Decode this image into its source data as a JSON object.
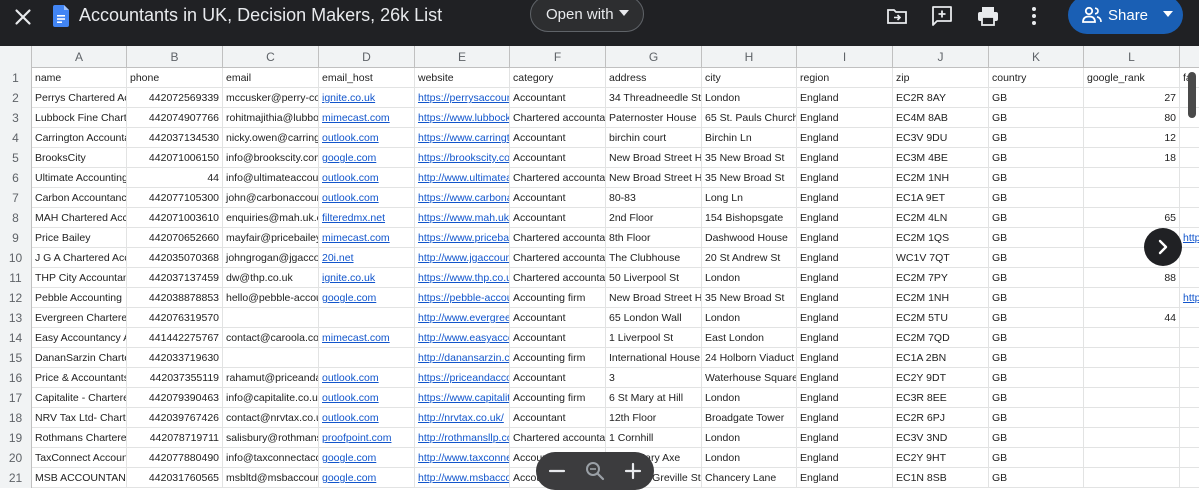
{
  "app": {
    "title": "Accountants in UK, Decision Makers, 26k List",
    "open_with_label": "Open with",
    "share_label": "Share"
  },
  "icons": {
    "close": "close-icon",
    "doc": "google-sheets-doc-icon",
    "move_to_folder": "move-to-folder-icon",
    "add_comment": "add-comment-icon",
    "print": "print-icon",
    "more": "more-vert-icon",
    "share_people": "people-icon",
    "next": "chevron-right-icon",
    "zoom_out": "zoom-out-icon",
    "zoom_reset": "zoom-magnifier-icon",
    "zoom_in": "zoom-in-icon"
  },
  "colors": {
    "topbar": "#202124",
    "share_button": "#1a5fb4",
    "link": "#1155cc",
    "header_bg": "#f1f3f4"
  },
  "grid": {
    "column_letters": [
      "A",
      "B",
      "C",
      "D",
      "E",
      "F",
      "G",
      "H",
      "I",
      "J",
      "K",
      "L"
    ],
    "row_numbers": [
      "1",
      "2",
      "3",
      "4",
      "5",
      "6",
      "7",
      "8",
      "9",
      "10",
      "11",
      "12",
      "13",
      "14",
      "15",
      "16",
      "17",
      "18",
      "19",
      "20",
      "21"
    ],
    "header": [
      "name",
      "phone",
      "email",
      "email_host",
      "website",
      "category",
      "address",
      "city",
      "region",
      "zip",
      "country",
      "google_rank",
      "fa"
    ],
    "rows": [
      [
        "Perrys Chartered Acc",
        "442072569339",
        "mccusker@perry-con",
        "ignite.co.uk",
        "https://perrysaccount",
        "Accountant",
        "34 Threadneedle St",
        "London",
        "England",
        "EC2R 8AY",
        "GB",
        "27",
        ""
      ],
      [
        "Lubbock Fine Charte",
        "442074907766",
        "rohitmajithia@lubbo",
        "mimecast.com",
        "https://www.lubbockf",
        "Chartered accountar",
        "Paternoster House",
        "65 St. Pauls Churchy",
        "England",
        "EC4M 8AB",
        "GB",
        "80",
        ""
      ],
      [
        "Carrington Accounta",
        "442037134530",
        "nicky.owen@carringt",
        "outlook.com",
        "https://www.carringto",
        "Accountant",
        "birchin court",
        "Birchin Ln",
        "England",
        "EC3V 9DU",
        "GB",
        "12",
        ""
      ],
      [
        "BrooksCity",
        "442071006150",
        "info@brookscity.com",
        "google.com",
        "https://brookscity.com",
        "Accountant",
        "New Broad Street Ho",
        "35 New Broad St",
        "England",
        "EC3M 4BE",
        "GB",
        "18",
        ""
      ],
      [
        "Ultimate Accounting",
        "44",
        "info@ultimateaccou",
        "outlook.com",
        "http://www.ultimatea",
        "Chartered accountar",
        "New Broad Street Ho",
        "35 New Broad St",
        "England",
        "EC2M 1NH",
        "GB",
        "",
        ""
      ],
      [
        "Carbon Accountancy",
        "442077105300",
        "john@carbonaccour",
        "outlook.com",
        "https://www.carbona",
        "Accountant",
        "80-83",
        "Long Ln",
        "England",
        "EC1A 9ET",
        "GB",
        "",
        ""
      ],
      [
        "MAH Chartered Acc",
        "442071003610",
        "enquiries@mah.uk.c",
        "filteredmx.net",
        "https://www.mah.uk.c",
        "Accountant",
        "2nd Floor",
        "154 Bishopsgate",
        "England",
        "EC2M 4LN",
        "GB",
        "65",
        ""
      ],
      [
        "Price Bailey",
        "442070652660",
        "mayfair@pricebailey",
        "mimecast.com",
        "https://www.pricebail",
        "Chartered accountar",
        "8th Floor",
        "Dashwood House",
        "England",
        "EC2M 1QS",
        "GB",
        "",
        "http"
      ],
      [
        "J G A Chartered Acc",
        "442035070368",
        "johngrogan@jgacco",
        "20i.net",
        "http://www.jgaccount",
        "Chartered accountar",
        "The Clubhouse",
        "20 St Andrew St",
        "England",
        "WC1V 7QT",
        "GB",
        "",
        ""
      ],
      [
        "THP City Accountan",
        "442037137459",
        "dw@thp.co.uk",
        "ignite.co.uk",
        "https://www.thp.co.uk",
        "Chartered accountar",
        "50 Liverpool St",
        "London",
        "England",
        "EC2M 7PY",
        "GB",
        "88",
        ""
      ],
      [
        "Pebble Accounting",
        "442038878853",
        "hello@pebble-accou",
        "google.com",
        "https://pebble-accou",
        "Accounting firm",
        "New Broad Street Ho",
        "35 New Broad St",
        "England",
        "EC2M 1NH",
        "GB",
        "",
        "http"
      ],
      [
        "Evergreen Chartered",
        "442076319570",
        "",
        "",
        "http://www.evergreen",
        "Accountant",
        "65 London Wall",
        "London",
        "England",
        "EC2M 5TU",
        "GB",
        "44",
        ""
      ],
      [
        "Easy Accountancy A",
        "441442275767",
        "contact@caroola.co",
        "mimecast.com",
        "http://www.easyacco",
        "Accountant",
        "1 Liverpool St",
        "East London",
        "England",
        "EC2M 7QD",
        "GB",
        "",
        ""
      ],
      [
        "DananSarzin Charte",
        "442033719630",
        "",
        "",
        "http://danansarzin.co",
        "Accounting firm",
        "International House",
        "24 Holborn Viaduct",
        "England",
        "EC1A 2BN",
        "GB",
        "",
        ""
      ],
      [
        "Price & Accountants",
        "442037355119",
        "rahamut@priceanda",
        "outlook.com",
        "https://priceandacco",
        "Accountant",
        "3",
        "Waterhouse Square",
        "England",
        "EC2Y 9DT",
        "GB",
        "",
        ""
      ],
      [
        "Capitalite - Chartere",
        "442079390463",
        "info@capitalite.co.uk",
        "outlook.com",
        "https://www.capitalite",
        "Accounting firm",
        "6 St Mary at Hill",
        "London",
        "England",
        "EC3R 8EE",
        "GB",
        "",
        ""
      ],
      [
        "NRV Tax Ltd- Charte",
        "442039767426",
        "contact@nrvtax.co.u",
        "outlook.com",
        "http://nrvtax.co.uk/",
        "Accountant",
        "12th Floor",
        "Broadgate Tower",
        "England",
        "EC2R 6PJ",
        "GB",
        "",
        ""
      ],
      [
        "Rothmans Chartered",
        "442078719711",
        "salisbury@rothmansl",
        "proofpoint.com",
        "http://rothmansllp.co",
        "Chartered accountar",
        "1 Cornhill",
        "London",
        "England",
        "EC3V 3ND",
        "GB",
        "",
        ""
      ],
      [
        "TaxConnect Accoun",
        "442077880490",
        "info@taxconnectacc",
        "google.com",
        "http://www.taxconne",
        "Accountant",
        "63 St Mary Axe",
        "London",
        "England",
        "EC2Y 9HT",
        "GB",
        "",
        ""
      ],
      [
        "MSB ACCOUNTANT",
        "442031760565",
        "msbltd@msbaccour",
        "google.com",
        "http://www.msbacco",
        "Accountant",
        "UG-8-14 Greville Stre",
        "Chancery Lane",
        "England",
        "EC1N 8SB",
        "GB",
        "",
        ""
      ]
    ]
  }
}
